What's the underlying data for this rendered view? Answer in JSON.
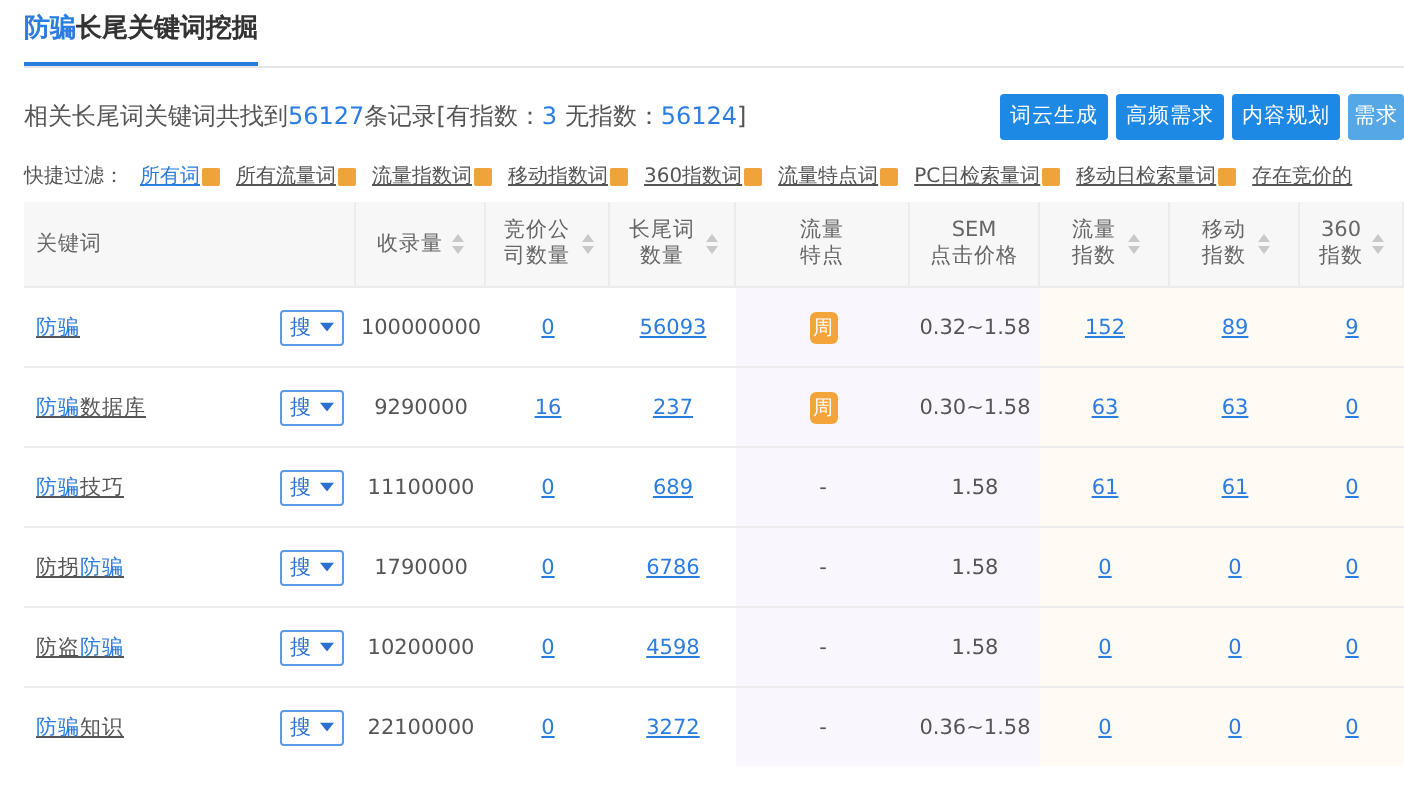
{
  "title": [
    {
      "text": "防骗",
      "highlight": true
    },
    {
      "text": "长尾关键词挖掘",
      "highlight": false
    }
  ],
  "summary": [
    {
      "text": "相关长尾词关键词共找到",
      "highlight": false
    },
    {
      "text": "56127",
      "highlight": true
    },
    {
      "text": "条记录[有指数：",
      "highlight": false
    },
    {
      "text": "3",
      "highlight": true
    },
    {
      "text": " 无指数：",
      "highlight": false
    },
    {
      "text": "56124",
      "highlight": true
    },
    {
      "text": "]",
      "highlight": false
    }
  ],
  "actions": [
    {
      "label": "词云生成",
      "disabled": false
    },
    {
      "label": "高频需求",
      "disabled": false
    },
    {
      "label": "内容规划",
      "disabled": false
    },
    {
      "label": "需求",
      "disabled": true
    }
  ],
  "filter_label": "快捷过滤：",
  "filters": [
    {
      "label": "所有词",
      "selected": true
    },
    {
      "label": "所有流量词",
      "selected": false
    },
    {
      "label": "流量指数词",
      "selected": false
    },
    {
      "label": "移动指数词",
      "selected": false
    },
    {
      "label": "360指数词",
      "selected": false
    },
    {
      "label": "流量特点词",
      "selected": false
    },
    {
      "label": "PC日检索量词",
      "selected": false
    },
    {
      "label": "移动日检索量词",
      "selected": false
    },
    {
      "label": "存在竞价的",
      "selected": false
    }
  ],
  "table": {
    "columns": [
      {
        "label": "关键词",
        "sortable": false
      },
      {
        "label": "收录量",
        "sortable": true
      },
      {
        "label": "竞价公司数量",
        "sortable": true
      },
      {
        "label": "长尾词数量",
        "sortable": true
      },
      {
        "label": "流量特点",
        "sortable": false
      },
      {
        "label": "SEM 点击价格",
        "sortable": false
      },
      {
        "label": "流量指数",
        "sortable": true
      },
      {
        "label": "移动指数",
        "sortable": true
      },
      {
        "label": "360 指数",
        "sortable": true
      }
    ],
    "rows": [
      {
        "search_label": "搜",
        "keyword": [
          {
            "text": "防骗",
            "highlight": true
          }
        ],
        "indexed": "100000000",
        "bidders": "0",
        "longtail": "56093",
        "feature": {
          "kind": "badge",
          "text": "周"
        },
        "sem_price": "0.32~1.58",
        "traffic_index": "152",
        "mobile_index": "89",
        "index_360": "9"
      },
      {
        "search_label": "搜",
        "keyword": [
          {
            "text": "防骗",
            "highlight": true
          },
          {
            "text": "数据库",
            "highlight": false
          }
        ],
        "indexed": "9290000",
        "bidders": "16",
        "longtail": "237",
        "feature": {
          "kind": "badge",
          "text": "周"
        },
        "sem_price": "0.30~1.58",
        "traffic_index": "63",
        "mobile_index": "63",
        "index_360": "0"
      },
      {
        "search_label": "搜",
        "keyword": [
          {
            "text": "防骗",
            "highlight": true
          },
          {
            "text": "技巧",
            "highlight": false
          }
        ],
        "indexed": "11100000",
        "bidders": "0",
        "longtail": "689",
        "feature": {
          "kind": "text",
          "text": "-"
        },
        "sem_price": "1.58",
        "traffic_index": "61",
        "mobile_index": "61",
        "index_360": "0"
      },
      {
        "search_label": "搜",
        "keyword": [
          {
            "text": "防拐",
            "highlight": false
          },
          {
            "text": "防骗",
            "highlight": true
          }
        ],
        "indexed": "1790000",
        "bidders": "0",
        "longtail": "6786",
        "feature": {
          "kind": "text",
          "text": "-"
        },
        "sem_price": "1.58",
        "traffic_index": "0",
        "mobile_index": "0",
        "index_360": "0"
      },
      {
        "search_label": "搜",
        "keyword": [
          {
            "text": "防盗",
            "highlight": false
          },
          {
            "text": "防骗",
            "highlight": true
          }
        ],
        "indexed": "10200000",
        "bidders": "0",
        "longtail": "4598",
        "feature": {
          "kind": "text",
          "text": "-"
        },
        "sem_price": "1.58",
        "traffic_index": "0",
        "mobile_index": "0",
        "index_360": "0"
      },
      {
        "search_label": "搜",
        "keyword": [
          {
            "text": "防骗",
            "highlight": true
          },
          {
            "text": "知识",
            "highlight": false
          }
        ],
        "indexed": "22100000",
        "bidders": "0",
        "longtail": "3272",
        "feature": {
          "kind": "text",
          "text": "-"
        },
        "sem_price": "0.36~1.58",
        "traffic_index": "0",
        "mobile_index": "0",
        "index_360": "0"
      }
    ]
  }
}
